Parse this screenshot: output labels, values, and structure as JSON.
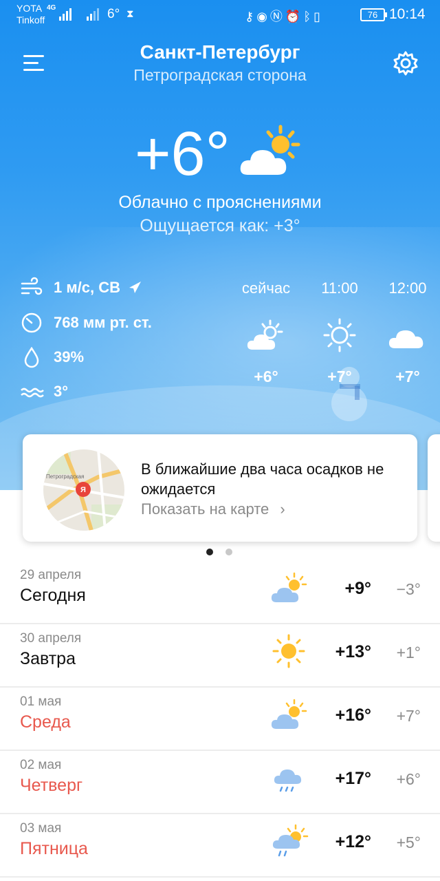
{
  "status_bar": {
    "carrier1": "YOTA",
    "carrier2": "Tinkoff",
    "network": "4G",
    "temperature": "6°",
    "battery": "76",
    "time": "10:14"
  },
  "header": {
    "city": "Санкт-Петербург",
    "district": "Петроградская сторона"
  },
  "current": {
    "temperature": "+6°",
    "condition": "Облачно с прояснениями",
    "feels_like": "Ощущается как: +3°",
    "icon": "partly-cloudy-icon"
  },
  "details": {
    "wind": "1 м/с, СВ",
    "pressure": "768 мм рт. ст.",
    "humidity": "39%",
    "water": "3°"
  },
  "hourly": [
    {
      "label": "сейчас",
      "icon": "partly-cloudy-icon",
      "temp": "+6°"
    },
    {
      "label": "11:00",
      "icon": "sun-icon",
      "temp": "+7°"
    },
    {
      "label": "12:00",
      "icon": "cloud-icon",
      "temp": "+7°"
    }
  ],
  "nowcast": {
    "text": "В ближайшие два часа осадков не ожидается",
    "link": "Показать на карте",
    "map_label": "Петроградская",
    "pin_label": "Я",
    "pages": 2,
    "active_page": 1
  },
  "forecast": [
    {
      "date": "29 апреля",
      "name": "Сегодня",
      "icon": "partly-cloudy-icon",
      "hi": "+9°",
      "lo": "−3°",
      "weekday": false
    },
    {
      "date": "30 апреля",
      "name": "Завтра",
      "icon": "sun-icon",
      "hi": "+13°",
      "lo": "+1°",
      "weekday": false
    },
    {
      "date": "01 мая",
      "name": "Среда",
      "icon": "partly-cloudy-icon",
      "hi": "+16°",
      "lo": "+7°",
      "weekday": true
    },
    {
      "date": "02 мая",
      "name": "Четверг",
      "icon": "cloud-rain-icon",
      "hi": "+17°",
      "lo": "+6°",
      "weekday": true
    },
    {
      "date": "03 мая",
      "name": "Пятница",
      "icon": "partly-cloudy-rain-icon",
      "hi": "+12°",
      "lo": "+5°",
      "weekday": true
    }
  ],
  "colors": {
    "sky_top": "#1a8ff0",
    "sky_bottom": "#7cc2f3",
    "weekday_red": "#e8584d",
    "sun_yellow": "#ffc02e",
    "cloud_blue": "#9cc4f0"
  }
}
